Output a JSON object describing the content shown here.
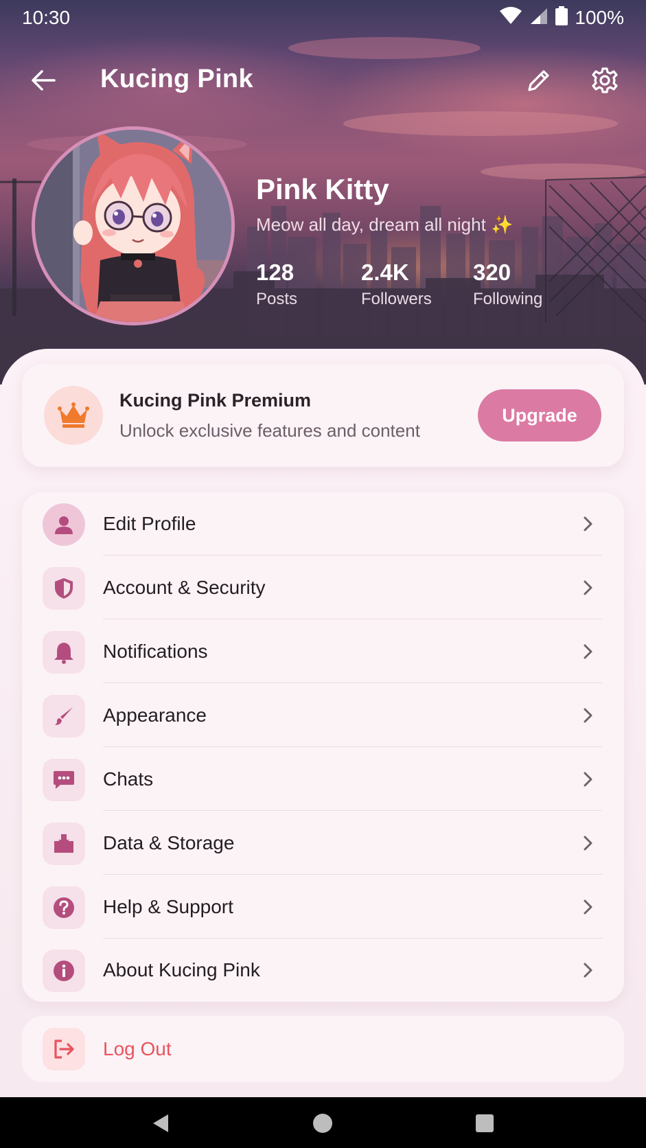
{
  "status_bar": {
    "time": "10:30",
    "battery": "100%"
  },
  "app_bar": {
    "title": "Kucing Pink"
  },
  "profile": {
    "name": "Pink Kitty",
    "bio": "Meow all day, dream all night ✨",
    "stats": [
      {
        "value": "128",
        "label": "Posts"
      },
      {
        "value": "2.4K",
        "label": "Followers"
      },
      {
        "value": "320",
        "label": "Following"
      }
    ]
  },
  "premium": {
    "title": "Kucing Pink Premium",
    "subtitle": "Unlock exclusive features and content",
    "button": "Upgrade"
  },
  "menu": {
    "items": [
      {
        "label": "Edit Profile",
        "icon": "person-icon"
      },
      {
        "label": "Account & Security",
        "icon": "shield-icon"
      },
      {
        "label": "Notifications",
        "icon": "bell-icon"
      },
      {
        "label": "Appearance",
        "icon": "brush-icon"
      },
      {
        "label": "Chats",
        "icon": "chat-icon"
      },
      {
        "label": "Data & Storage",
        "icon": "storage-icon"
      },
      {
        "label": "Help & Support",
        "icon": "help-icon"
      },
      {
        "label": "About Kucing Pink",
        "icon": "info-icon"
      }
    ]
  },
  "logout": {
    "label": "Log Out"
  },
  "colors": {
    "accent": "#db7aa3",
    "icon_tint": "#b44d7e",
    "danger": "#e8545d",
    "crown": "#f07a2e"
  }
}
